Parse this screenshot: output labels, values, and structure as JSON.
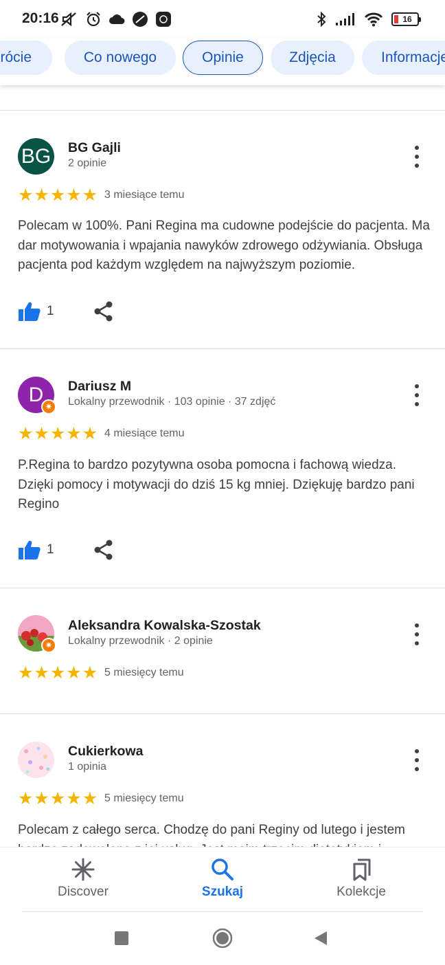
{
  "status_bar": {
    "time": "20:16",
    "battery": "16",
    "icons_left": [
      "mute-icon",
      "alarm-icon",
      "cloud-icon",
      "app-icon",
      "notification-icon"
    ],
    "icons_right": [
      "bluetooth-icon",
      "signal-icon",
      "wifi-icon",
      "battery-icon"
    ]
  },
  "tabs": [
    {
      "label": "krócie",
      "active": false
    },
    {
      "label": "Co nowego",
      "active": false
    },
    {
      "label": "Opinie",
      "active": true
    },
    {
      "label": "Zdjęcia",
      "active": false
    },
    {
      "label": "Informacje",
      "active": false
    }
  ],
  "reviews": [
    {
      "initials": "BG",
      "avatar_color": "#0b5345",
      "name": "BG Gajli",
      "meta": "2 opinie",
      "rating": 5,
      "when": "3 miesiące temu",
      "text": "Polecam w 100%. Pani Regina ma cudowne podejście do pacjenta. Ma dar motywowania i wpajania nawyków zdrowego odżywiania. Obsługa pacjenta pod każdym względem na najwyższym poziomie.",
      "likes": "1"
    },
    {
      "initials": "D",
      "avatar_color": "#8e24aa",
      "name": "Dariusz M",
      "meta": "Lokalny przewodnik · 103 opinie · 37 zdjęć",
      "rating": 5,
      "when": "4 miesiące temu",
      "text": "P.Regina to bardzo pozytywna osoba pomocna i fachową wiedza. Dzięki pomocy i motywacji do dziś 15 kg mniej. Dziękuję bardzo pani Regino",
      "likes": "1"
    },
    {
      "name": "Aleksandra Kowalska-Szostak",
      "meta": "Lokalny przewodnik · 2 opinie",
      "rating": 5,
      "when": "5 miesięcy temu"
    },
    {
      "name": "Cukierkowa",
      "meta": "1 opinia",
      "rating": 5,
      "when": "5 miesięcy temu",
      "text": "Polecam z całego serca. Chodzę do pani Reginy od lutego i jestem bardzo zadowolona z jej usług. Jest moim trzecim dietetykiem i"
    }
  ],
  "bottom_nav": [
    {
      "label": "Discover",
      "icon": "asterisk-icon",
      "active": false
    },
    {
      "label": "Szukaj",
      "icon": "search-icon",
      "active": true
    },
    {
      "label": "Kolekcje",
      "icon": "bookmarks-icon",
      "active": false
    }
  ],
  "colors": {
    "accent": "#1a73e8",
    "star": "#f4b400",
    "tab_bg": "#e8f0fe"
  }
}
